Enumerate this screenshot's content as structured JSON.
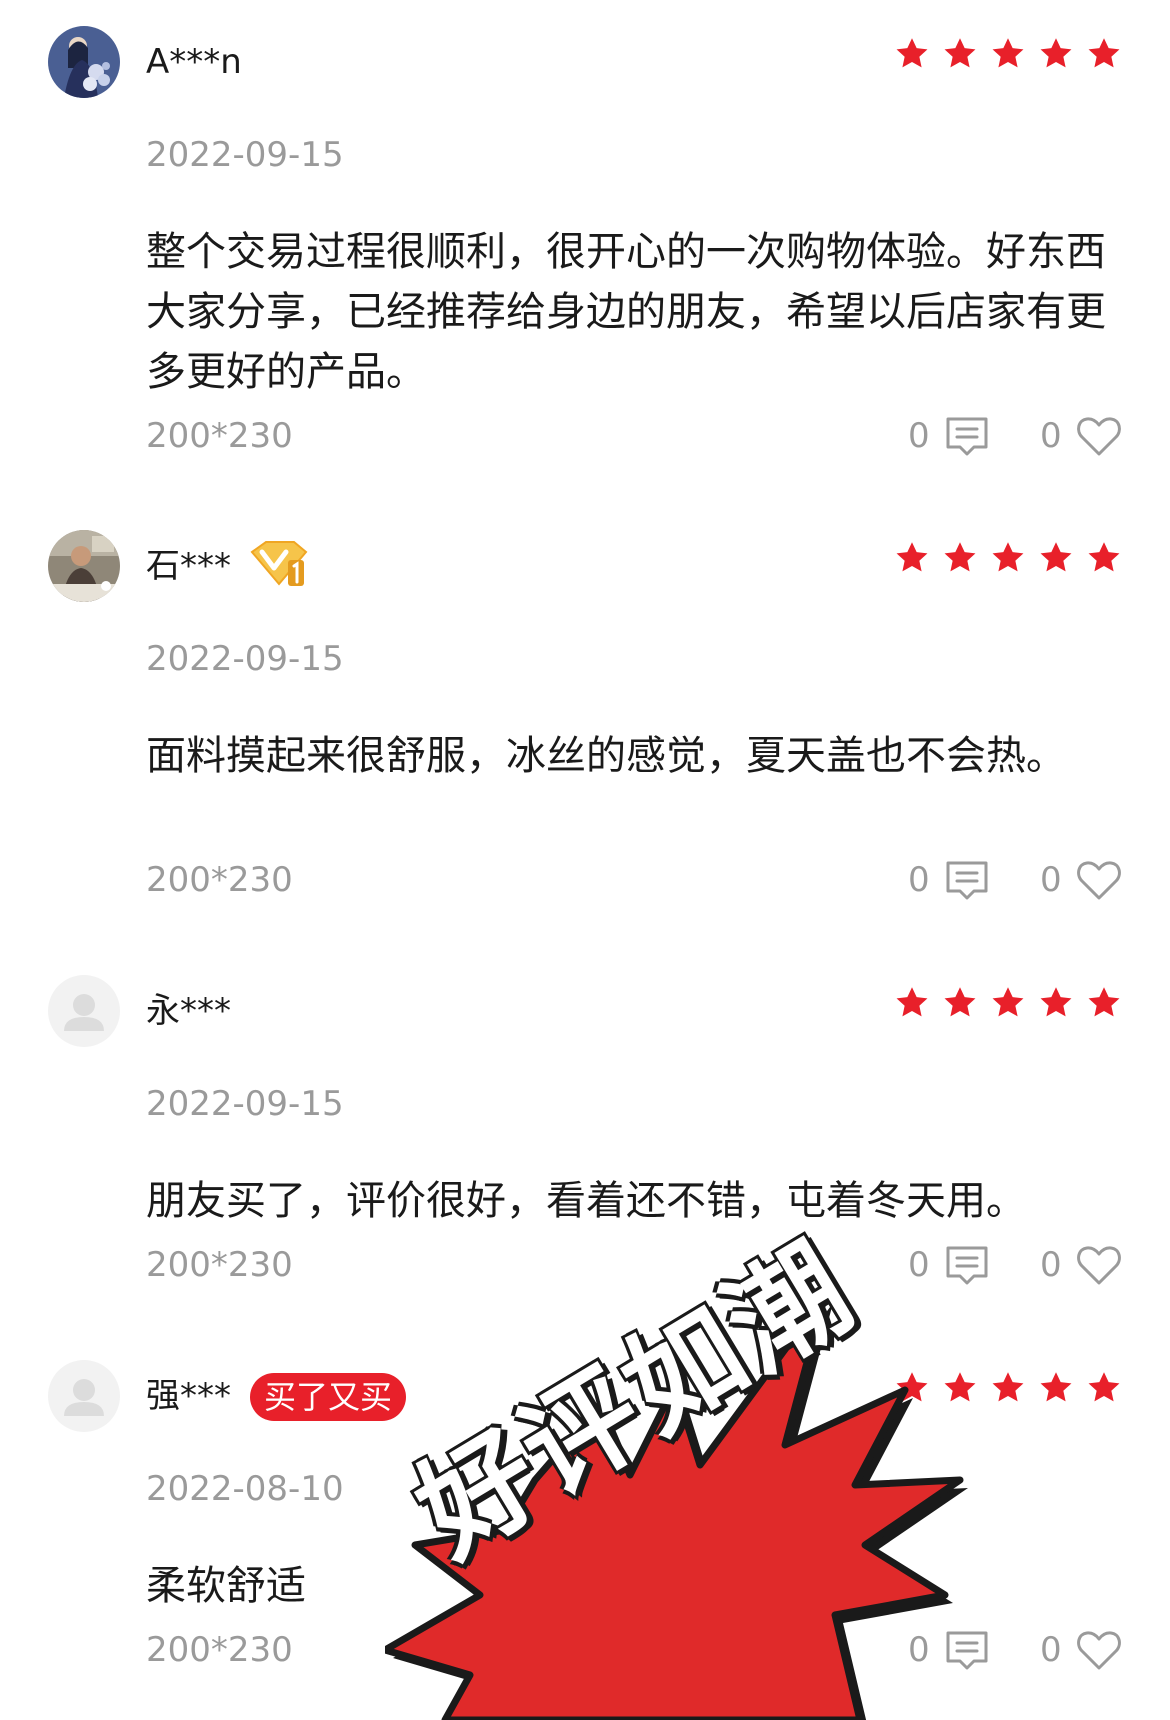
{
  "reviews": [
    {
      "username": "A***n",
      "date": "2022-09-15",
      "content": "整个交易过程很顺利，很开心的一次购物体验。好东西大家分享，已经推荐给身边的朋友，希望以后店家有更多更好的产品。",
      "size": "200*230",
      "comment_count": "0",
      "like_count": "0",
      "rating": 5,
      "avatar": "photo-girl-flowers"
    },
    {
      "username": "石***",
      "badge_icon": "gold-vip-v1-icon",
      "date": "2022-09-15",
      "content": "面料摸起来很舒服，冰丝的感觉，夏天盖也不会热。",
      "size": "200*230",
      "comment_count": "0",
      "like_count": "0",
      "rating": 5,
      "avatar": "photo-man-dining"
    },
    {
      "username": "永***",
      "date": "2022-09-15",
      "content": "朋友买了，评价很好，看着还不错，屯着冬天用。",
      "size": "200*230",
      "comment_count": "0",
      "like_count": "0",
      "rating": 5,
      "avatar": "default-user"
    },
    {
      "username": "强***",
      "tag": "买了又买",
      "date": "2022-08-10",
      "content": "柔软舒适",
      "size": "200*230",
      "comment_count": "0",
      "like_count": "0",
      "rating": 5,
      "avatar": "default-user"
    }
  ],
  "overlay": {
    "text": "好评如潮",
    "burst_color": "#e02a2a"
  },
  "colors": {
    "star": "#e8202a",
    "meta_text": "#9a9a9a",
    "badge_bg": "#e8202a",
    "vip_gold": "#f3b73a"
  },
  "icons": {
    "comment": "comment-icon",
    "like": "heart-icon",
    "star": "star-icon"
  }
}
